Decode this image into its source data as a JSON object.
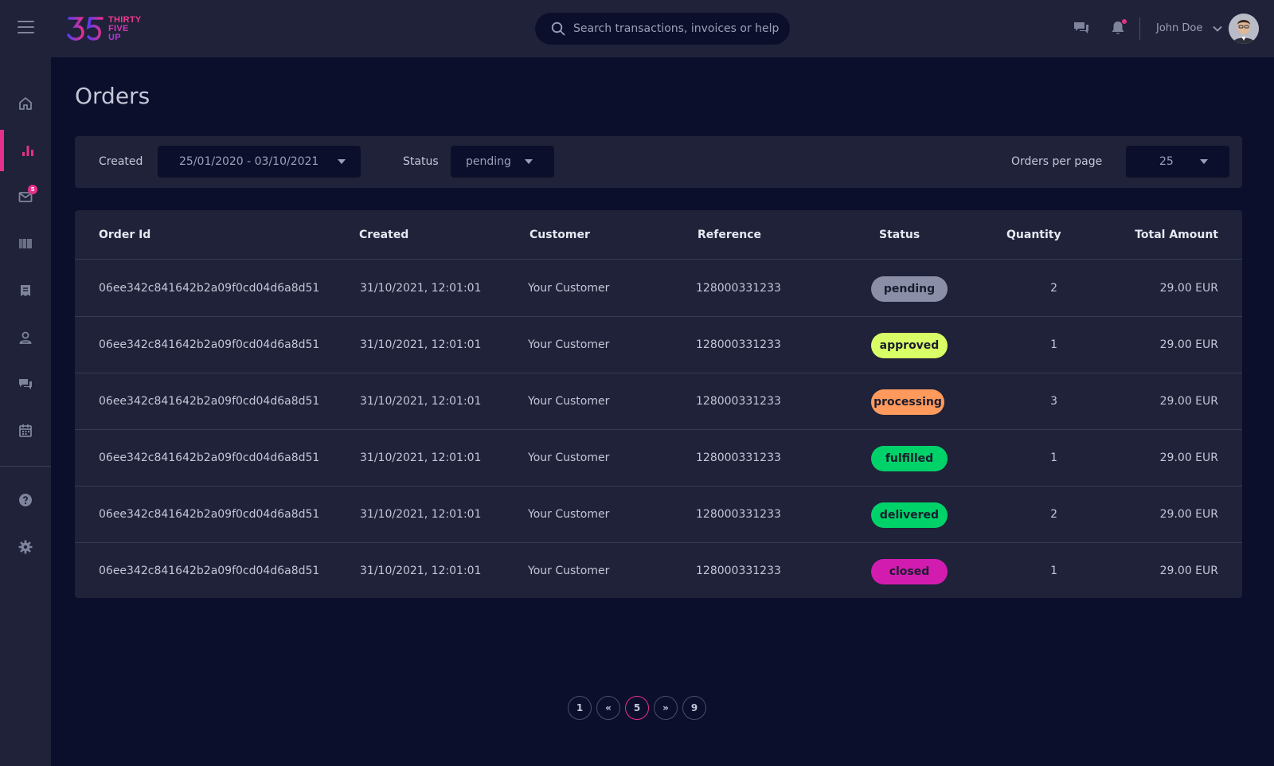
{
  "brand": {
    "logo_mark": "35",
    "logo_lines": [
      "THIRTY",
      "FIVE",
      "UP"
    ],
    "colors": {
      "accent": "#e4308a",
      "sidebar_bg": "#1f2238",
      "page_bg": "#0c0f2b"
    }
  },
  "sidebar": {
    "items": [
      {
        "icon": "home-icon",
        "active": false
      },
      {
        "icon": "chart-icon",
        "active": true
      },
      {
        "icon": "mail-icon",
        "active": false,
        "badge": "5"
      },
      {
        "icon": "barcode-icon",
        "active": false
      },
      {
        "icon": "receipt-icon",
        "active": false
      },
      {
        "icon": "user-icon",
        "active": false
      },
      {
        "icon": "chat-icon",
        "active": false
      },
      {
        "icon": "calendar-icon",
        "active": false
      },
      {
        "icon": "help-icon",
        "active": false
      },
      {
        "icon": "settings-icon",
        "active": false
      }
    ]
  },
  "header": {
    "search_placeholder": "Search transactions, invoices or help",
    "user_name": "John Doe"
  },
  "page": {
    "title": "Orders"
  },
  "filters": {
    "created_label": "Created",
    "created_value": "25/01/2020 - 03/10/2021",
    "status_label": "Status",
    "status_value": "pending",
    "per_page_label": "Orders per page",
    "per_page_value": "25"
  },
  "table": {
    "columns": [
      "Order Id",
      "Created",
      "Customer",
      "Reference",
      "Status",
      "Quantity",
      "Total  Amount"
    ],
    "rows": [
      {
        "order_id": "06ee342c841642b2a09f0cd04d6a8d51",
        "created": "31/10/2021, 12:01:01",
        "customer": "Your Customer",
        "reference": "128000331233",
        "status": "pending",
        "status_color": "#8a8ea6",
        "quantity": "2",
        "total": "29.00 EUR"
      },
      {
        "order_id": "06ee342c841642b2a09f0cd04d6a8d51",
        "created": "31/10/2021, 12:01:01",
        "customer": "Your Customer",
        "reference": "128000331233",
        "status": "approved",
        "status_color": "#d9ff66",
        "quantity": "1",
        "total": "29.00 EUR"
      },
      {
        "order_id": "06ee342c841642b2a09f0cd04d6a8d51",
        "created": "31/10/2021, 12:01:01",
        "customer": "Your Customer",
        "reference": "128000331233",
        "status": "processing",
        "status_color": "#ff9a5c",
        "quantity": "3",
        "total": "29.00 EUR"
      },
      {
        "order_id": "06ee342c841642b2a09f0cd04d6a8d51",
        "created": "31/10/2021, 12:01:01",
        "customer": "Your Customer",
        "reference": "128000331233",
        "status": "fulfilled",
        "status_color": "#00d26a",
        "quantity": "1",
        "total": "29.00 EUR"
      },
      {
        "order_id": "06ee342c841642b2a09f0cd04d6a8d51",
        "created": "31/10/2021, 12:01:01",
        "customer": "Your Customer",
        "reference": "128000331233",
        "status": "delivered",
        "status_color": "#00d26a",
        "quantity": "2",
        "total": "29.00 EUR"
      },
      {
        "order_id": "06ee342c841642b2a09f0cd04d6a8d51",
        "created": "31/10/2021, 12:01:01",
        "customer": "Your Customer",
        "reference": "128000331233",
        "status": "closed",
        "status_color": "#d21cb0",
        "quantity": "1",
        "total": "29.00 EUR"
      }
    ]
  },
  "pagination": {
    "first": "1",
    "prev": "«",
    "current": "5",
    "next": "»",
    "last": "9"
  }
}
